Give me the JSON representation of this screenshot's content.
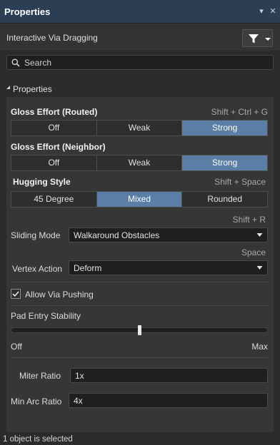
{
  "window": {
    "title": "Properties",
    "pin_icon": "dropdown-arrow-icon",
    "pin_glyph": "▾",
    "close_glyph": "✕"
  },
  "header": {
    "subtitle": "Interactive Via Dragging",
    "filter_icon": "filter-icon"
  },
  "search": {
    "placeholder": "Search",
    "value": ""
  },
  "section": {
    "label": "Properties",
    "collapse_icon": "triangle-down-icon"
  },
  "gloss_routed": {
    "label": "Gloss Effort (Routed)",
    "shortcut": "Shift + Ctrl + G",
    "options": [
      "Off",
      "Weak",
      "Strong"
    ],
    "selected": "Strong"
  },
  "gloss_neighbor": {
    "label": "Gloss Effort (Neighbor)",
    "options": [
      "Off",
      "Weak",
      "Strong"
    ],
    "selected": "Strong"
  },
  "hugging": {
    "label": "Hugging Style",
    "shortcut": "Shift + Space",
    "options": [
      "45 Degree",
      "Mixed",
      "Rounded"
    ],
    "selected": "Mixed"
  },
  "sliding": {
    "shortcut": "Shift + R",
    "label": "Sliding Mode",
    "value": "Walkaround Obstacles"
  },
  "vertex": {
    "shortcut": "Space",
    "label": "Vertex Action",
    "value": "Deform"
  },
  "allow_via_pushing": {
    "label": "Allow Via Pushing",
    "checked": true
  },
  "pad_entry": {
    "label": "Pad Entry Stability",
    "min_label": "Off",
    "max_label": "Max",
    "value_fraction": 0.5
  },
  "miter": {
    "label": "Miter Ratio",
    "value": "1x"
  },
  "min_arc": {
    "label": "Min Arc Ratio",
    "value": "4x"
  },
  "status": {
    "text": "1 object is selected"
  },
  "colors": {
    "title_bar": "#2b3e54",
    "selected_segment": "#5a7ea6",
    "panel": "#363636"
  }
}
